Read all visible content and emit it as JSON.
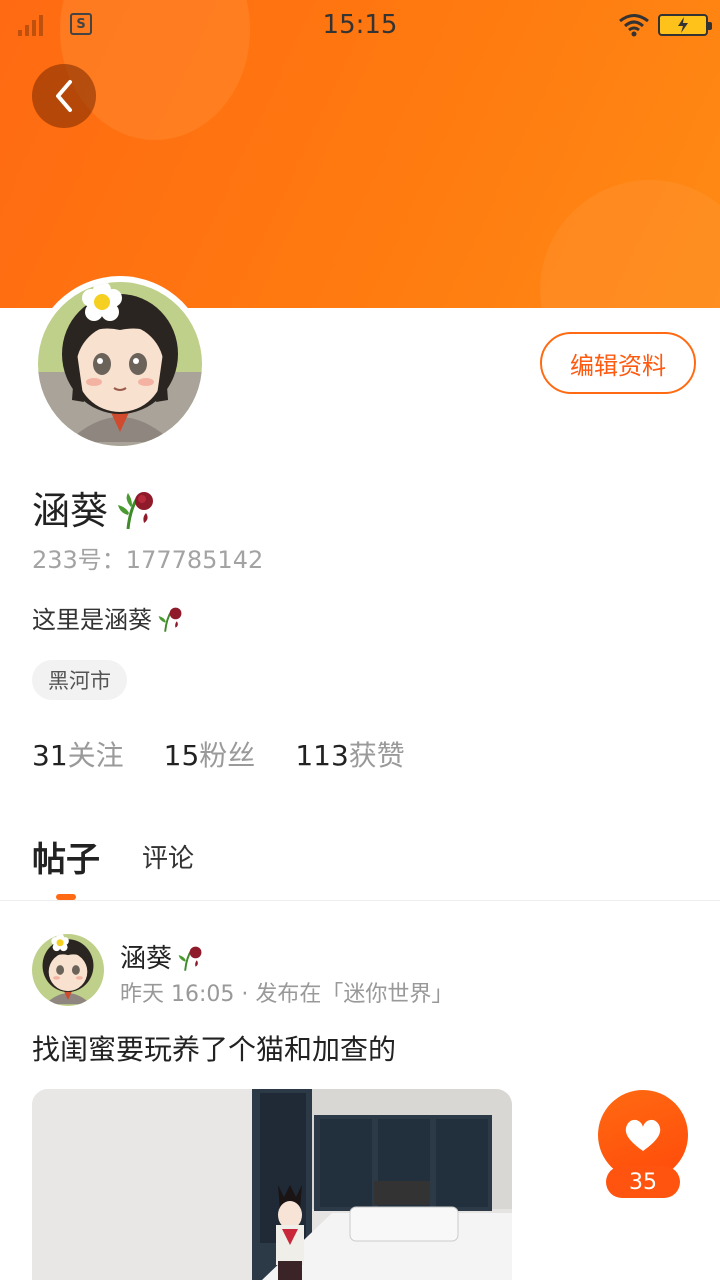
{
  "status_bar": {
    "time": "15:15",
    "carrier_badge": "S"
  },
  "profile": {
    "name": "涵葵",
    "uid_label": "233号：177785142",
    "bio": "这里是涵葵",
    "location": "黑河市",
    "edit_button": "编辑资料",
    "stats": [
      {
        "num": "31",
        "label": "关注"
      },
      {
        "num": "15",
        "label": "粉丝"
      },
      {
        "num": "113",
        "label": "获赞"
      }
    ]
  },
  "tabs": [
    {
      "label": "帖子"
    },
    {
      "label": "评论"
    }
  ],
  "post": {
    "author": "涵葵",
    "meta": "昨天 16:05 · 发布在「迷你世界」",
    "text": "找闺蜜要玩养了个猫和加查的",
    "like_count": "35"
  },
  "colors": {
    "accent": "#ff6a12",
    "banner_start": "#ff6a12",
    "banner_end": "#ff8a14"
  },
  "icons": [
    "signal-icon",
    "sim-s-icon",
    "wifi-icon",
    "battery-icon",
    "back-chevron-icon",
    "wilted-rose-icon",
    "heart-icon"
  ]
}
